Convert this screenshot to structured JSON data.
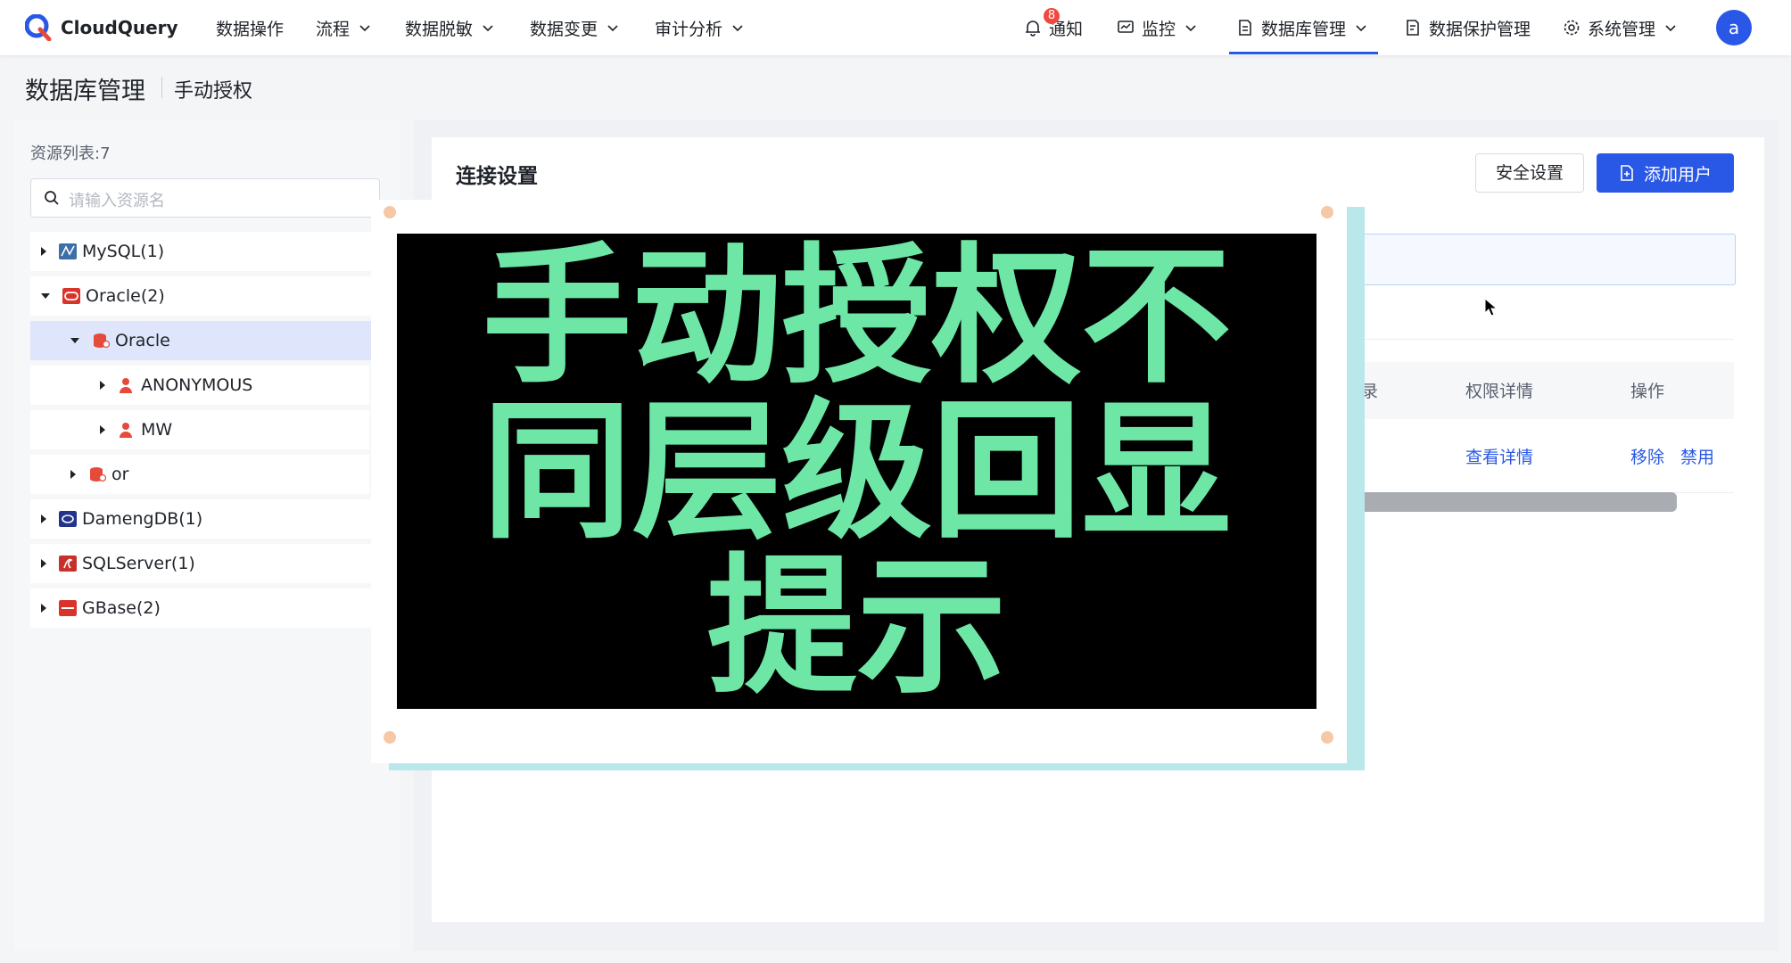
{
  "app": {
    "name": "CloudQuery"
  },
  "nav": {
    "items": [
      {
        "label": "数据操作",
        "has_menu": false
      },
      {
        "label": "流程",
        "has_menu": true
      },
      {
        "label": "数据脱敏",
        "has_menu": true
      },
      {
        "label": "数据变更",
        "has_menu": true
      },
      {
        "label": "审计分析",
        "has_menu": true
      }
    ],
    "right": {
      "notify_label": "通知",
      "notify_count": "8",
      "monitor_label": "监控",
      "dbmanage_label": "数据库管理",
      "protect_label": "数据保护管理",
      "system_label": "系统管理",
      "avatar": "a"
    }
  },
  "page": {
    "title": "数据库管理",
    "subtitle": "手动授权"
  },
  "sidebar": {
    "resource_count_label": "资源列表:7",
    "search_placeholder": "请输入资源名",
    "tree": [
      {
        "label": "MySQL(1)",
        "level": 0,
        "expanded": false,
        "icon": "mysql-icon"
      },
      {
        "label": "Oracle(2)",
        "level": 0,
        "expanded": true,
        "icon": "oracle-icon"
      },
      {
        "label": "Oracle",
        "level": 1,
        "expanded": true,
        "selected": true,
        "icon": "database-icon"
      },
      {
        "label": "ANONYMOUS",
        "level": 2,
        "expanded": false,
        "icon": "user-icon"
      },
      {
        "label": "MW",
        "level": 2,
        "expanded": false,
        "icon": "user-icon"
      },
      {
        "label": "or",
        "level": 1,
        "expanded": false,
        "icon": "database-icon"
      },
      {
        "label": "DamengDB(1)",
        "level": 0,
        "expanded": false,
        "icon": "dameng-icon"
      },
      {
        "label": "SQLServer(1)",
        "level": 0,
        "expanded": false,
        "icon": "sqlserver-icon"
      },
      {
        "label": "GBase(2)",
        "level": 0,
        "expanded": false,
        "icon": "gbase-icon"
      }
    ]
  },
  "main": {
    "title": "连接设置",
    "security_button": "安全设置",
    "add_user_button": "添加用户",
    "table": {
      "partial_header": "录",
      "headers": [
        "权限详情",
        "操作"
      ],
      "row": {
        "detail_link": "查看详情",
        "remove_link": "移除",
        "disable_link": "禁用"
      }
    }
  },
  "overlay": {
    "caption": "手动授权不同层级回显提示"
  },
  "colors": {
    "brand": "#2a58e6",
    "caption_text": "#6ee6a6",
    "badge": "#f0483e",
    "selected_row": "#dfe6fb"
  }
}
